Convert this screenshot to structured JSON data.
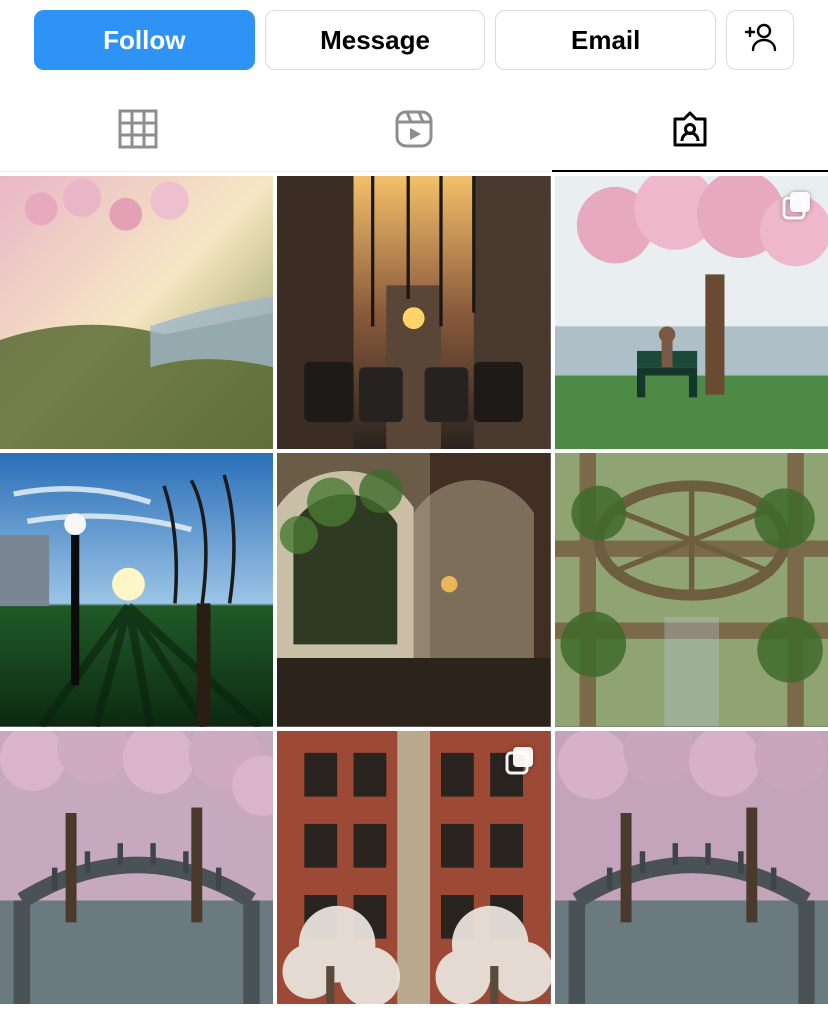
{
  "actions": {
    "follow": "Follow",
    "message": "Message",
    "email": "Email"
  },
  "tabs": {
    "grid": "grid",
    "reels": "reels",
    "tagged": "tagged",
    "active": "tagged"
  },
  "posts": [
    {
      "desc": "cherry blossoms over river at sunrise",
      "multi": false
    },
    {
      "desc": "narrow city street with parked cars at sunset",
      "multi": false
    },
    {
      "desc": "woman on bench under cherry tree by lake",
      "multi": true
    },
    {
      "desc": "park with lamppost, bare tree and green grass",
      "multi": false
    },
    {
      "desc": "stone arches entrance with ivy",
      "multi": false
    },
    {
      "desc": "wooden pergola with round trellis and vines",
      "multi": false
    },
    {
      "desc": "footbridge framed by pink blossoms",
      "multi": false
    },
    {
      "desc": "red brick building with white flowering trees",
      "multi": true
    },
    {
      "desc": "footbridge framed by pink blossoms (similar)",
      "multi": false
    }
  ]
}
